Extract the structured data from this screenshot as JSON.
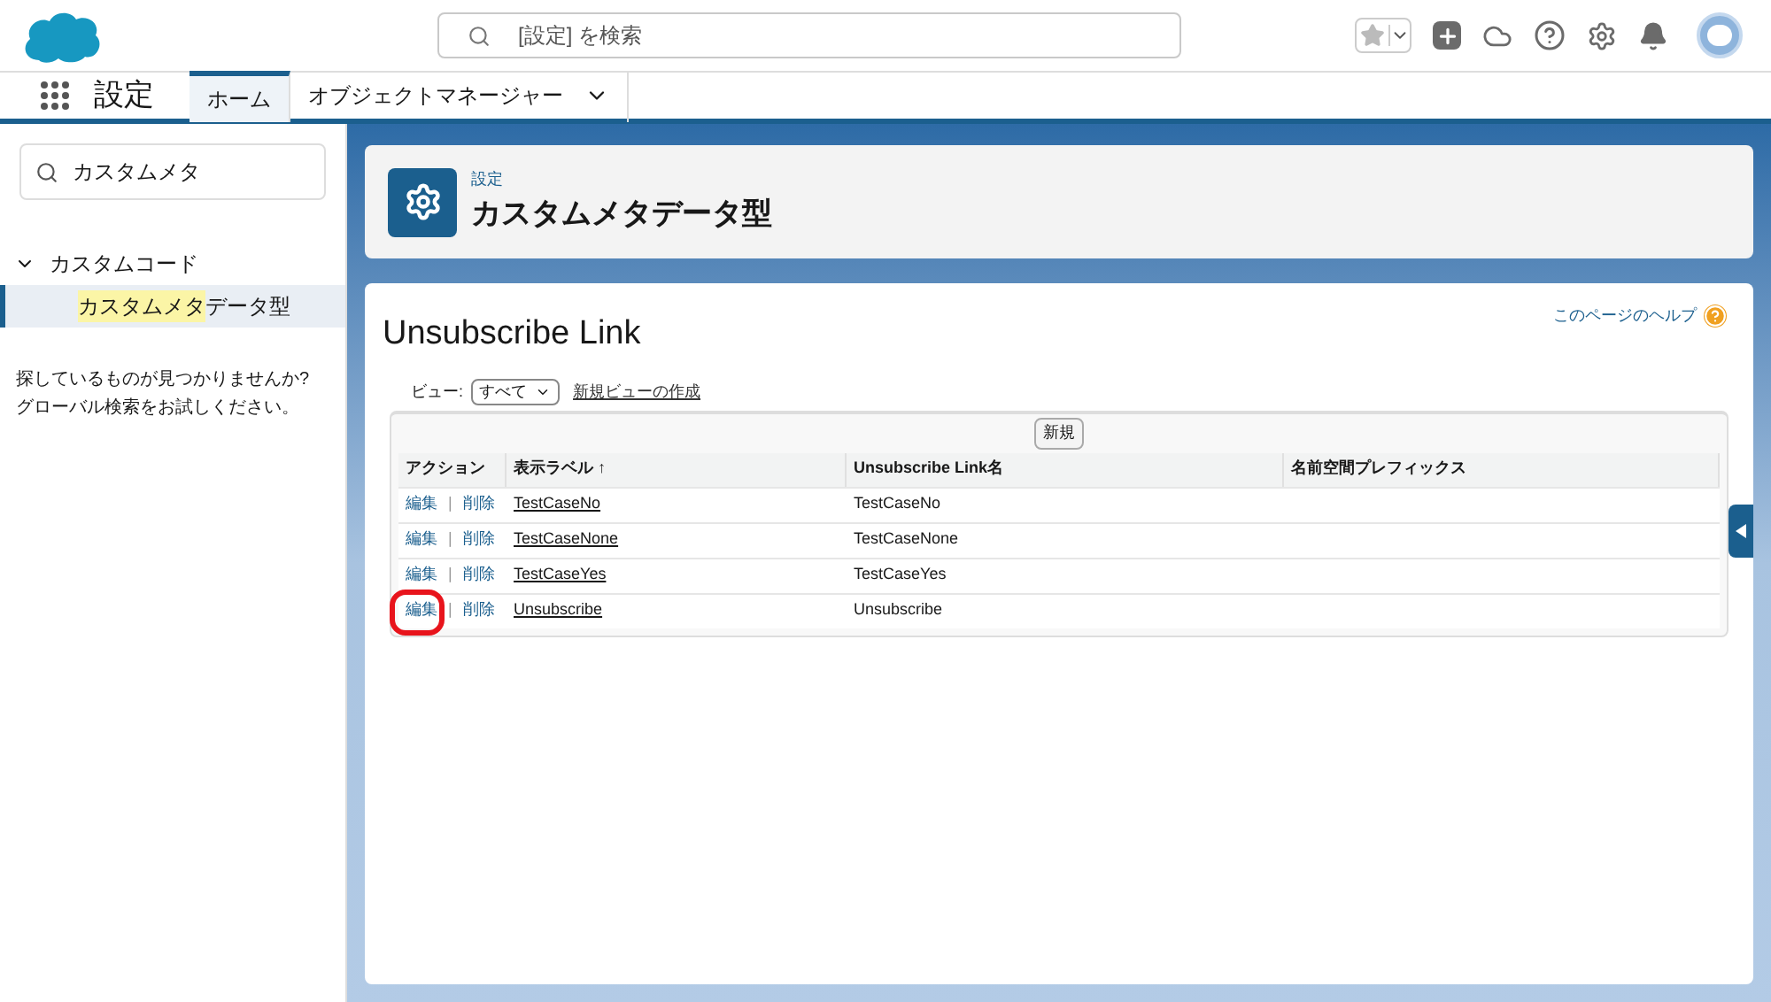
{
  "header": {
    "search_placeholder": "[設定] を検索"
  },
  "nav": {
    "app_name": "設定",
    "tabs": [
      {
        "label": "ホーム",
        "selected": true,
        "has_menu": false
      },
      {
        "label": "オブジェクトマネージャー",
        "selected": false,
        "has_menu": true
      }
    ]
  },
  "sidebar": {
    "search_value": "カスタムメタ",
    "tree": [
      {
        "label": "カスタムコード",
        "expanded": true,
        "children": [
          {
            "match": "カスタムメタ",
            "rest": "データ型",
            "selected": true
          }
        ]
      }
    ],
    "hint": "探しているものが見つかりませんか? グローバル検索をお試しください。"
  },
  "page_header": {
    "breadcrumb": "設定",
    "title": "カスタムメタデータ型"
  },
  "content": {
    "title": "Unsubscribe Link",
    "help_link": "このページのヘルプ",
    "view_label": "ビュー:",
    "view_value": "すべて",
    "new_view_link": "新規ビューの作成",
    "new_button": "新規",
    "table": {
      "columns": [
        "アクション",
        "表示ラベル ↑",
        "Unsubscribe Link名",
        "名前空間プレフィックス"
      ],
      "rows": [
        {
          "edit": "編集",
          "separator": "|",
          "delete": "削除",
          "label": "TestCaseNo",
          "name": "TestCaseNo",
          "circled": false
        },
        {
          "edit": "編集",
          "separator": "|",
          "delete": "削除",
          "label": "TestCaseNone",
          "name": "TestCaseNone",
          "circled": false
        },
        {
          "edit": "編集",
          "separator": "|",
          "delete": "削除",
          "label": "TestCaseYes",
          "name": "TestCaseYes",
          "circled": false
        },
        {
          "edit": "編集",
          "separator": "|",
          "delete": "削除",
          "label": "Unsubscribe",
          "name": "Unsubscribe",
          "circled": true
        }
      ]
    }
  }
}
